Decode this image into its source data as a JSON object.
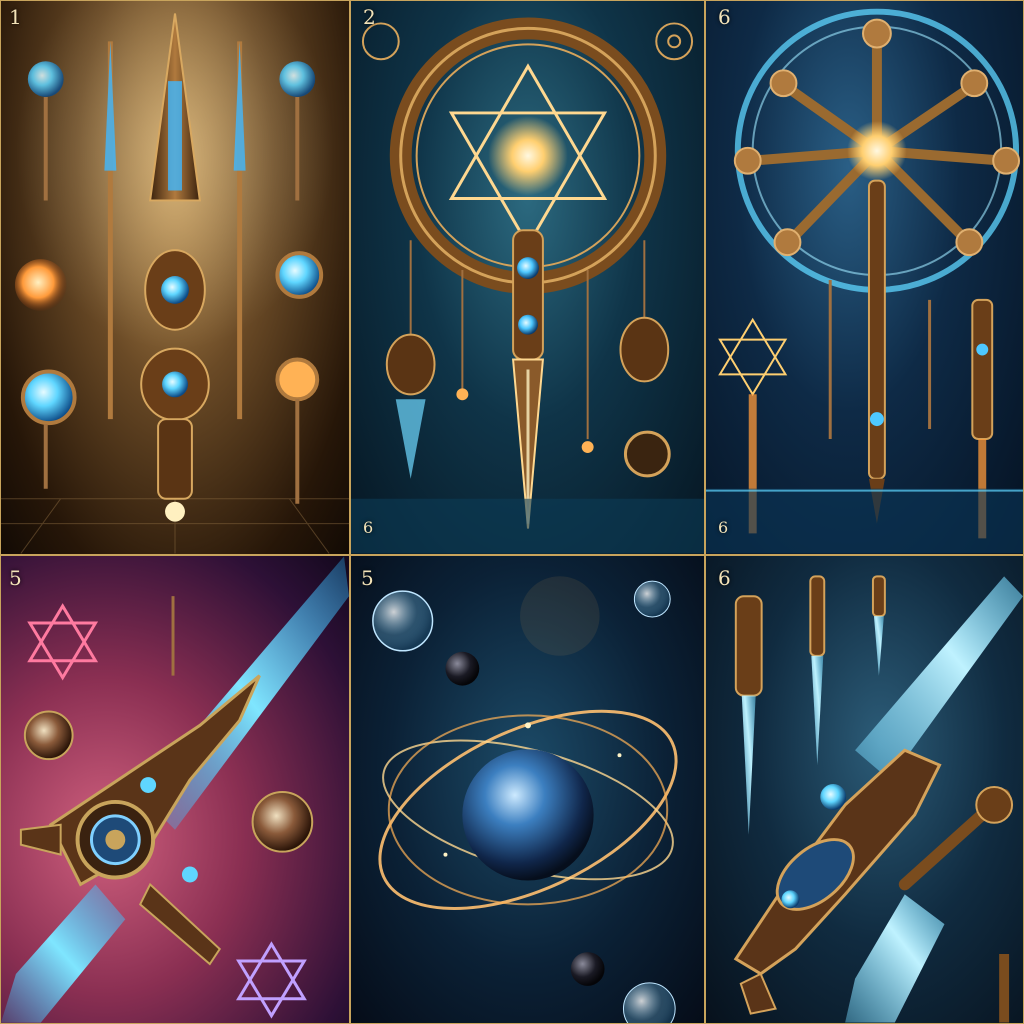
{
  "panels": [
    {
      "id": "p1",
      "label": "1"
    },
    {
      "id": "p2",
      "label": "2",
      "corner_label": "6"
    },
    {
      "id": "p3",
      "label": "6",
      "corner_label": "6"
    },
    {
      "id": "p4",
      "label": "5"
    },
    {
      "id": "p5",
      "label": "5"
    },
    {
      "id": "p6",
      "label": "6"
    }
  ],
  "colors": {
    "gold": "#c8a45c",
    "bronze": "#8a5a2a",
    "glow_blue": "#5fd6ff",
    "glow_orange": "#ffb255"
  }
}
